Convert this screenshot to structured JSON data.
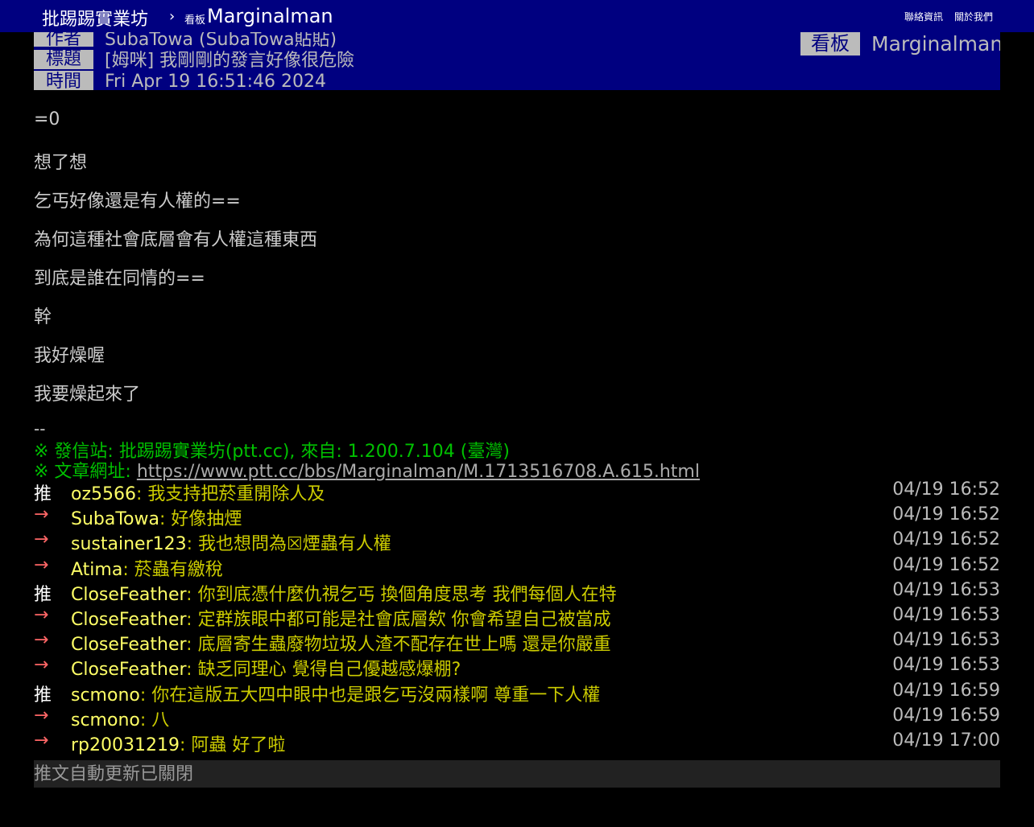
{
  "topbar": {
    "site_name": "批踢踢實業坊",
    "separator": "›",
    "board_label": "看板",
    "board_name": "Marginalman",
    "nav_contact": "聯絡資訊",
    "nav_about": "關於我們"
  },
  "meta": {
    "author_tag": "作者",
    "author": "SubaTowa (SubaTowa貼貼)",
    "board_tag": "看板",
    "board": "Marginalman",
    "title_tag": "標題",
    "title": "[姆咪] 我剛剛的發言好像很危險",
    "time_tag": "時間",
    "time": "Fri Apr 19 16:51:46 2024"
  },
  "body": [
    "=0",
    "想了想",
    "乞丐好像還是有人權的==",
    "為何這種社會底層會有人權這種東西",
    "到底是誰在同情的==",
    "幹",
    "我好燥喔",
    "我要燥起來了"
  ],
  "signature": {
    "dash": "--",
    "origin": "※ 發信站: 批踢踢實業坊(ptt.cc), 來自: 1.200.7.104 (臺灣)",
    "url_prefix": "※ 文章網址: ",
    "url": "https://www.ptt.cc/bbs/Marginalman/M.1713516708.A.615.html"
  },
  "pushes": [
    {
      "tag": "推",
      "user": "oz5566",
      "content": ": 我支持把菸重開除人及",
      "time": "04/19 16:52"
    },
    {
      "tag": "→",
      "user": "SubaTowa",
      "content": ": 好像抽煙",
      "time": "04/19 16:52"
    },
    {
      "tag": "→",
      "user": "sustainer123",
      "content": ": 我也想問為☒煙蟲有人權",
      "time": "04/19 16:52"
    },
    {
      "tag": "→",
      "user": "Atima",
      "content": ": 菸蟲有繳稅",
      "time": "04/19 16:52"
    },
    {
      "tag": "推",
      "user": "CloseFeather",
      "content": ": 你到底憑什麼仇視乞丐 換個角度思考 我們每個人在特",
      "time": "04/19 16:53"
    },
    {
      "tag": "→",
      "user": "CloseFeather",
      "content": ": 定群族眼中都可能是社會底層欸 你會希望自己被當成",
      "time": "04/19 16:53"
    },
    {
      "tag": "→",
      "user": "CloseFeather",
      "content": ": 底層寄生蟲廢物垃圾人渣不配存在世上嗎 還是你嚴重",
      "time": "04/19 16:53"
    },
    {
      "tag": "→",
      "user": "CloseFeather",
      "content": ": 缺乏同理心 覺得自己優越感爆棚?",
      "time": "04/19 16:53"
    },
    {
      "tag": "推",
      "user": "scmono",
      "content": ": 你在這版五大四中眼中也是跟乞丐沒兩樣啊  尊重一下人權",
      "time": "04/19 16:59"
    },
    {
      "tag": "→",
      "user": "scmono",
      "content": ": 八",
      "time": "04/19 16:59"
    },
    {
      "tag": "→",
      "user": "rp20031219",
      "content": ": 阿蟲 好了啦",
      "time": "04/19 17:00"
    }
  ],
  "autoupdate": "推文自動更新已關閉",
  "colors": {
    "nav_bg": "#000080",
    "push_user": "#ffff66",
    "push_content": "#cccc00",
    "arrow": "#ff6666",
    "signature": "#00c000"
  }
}
